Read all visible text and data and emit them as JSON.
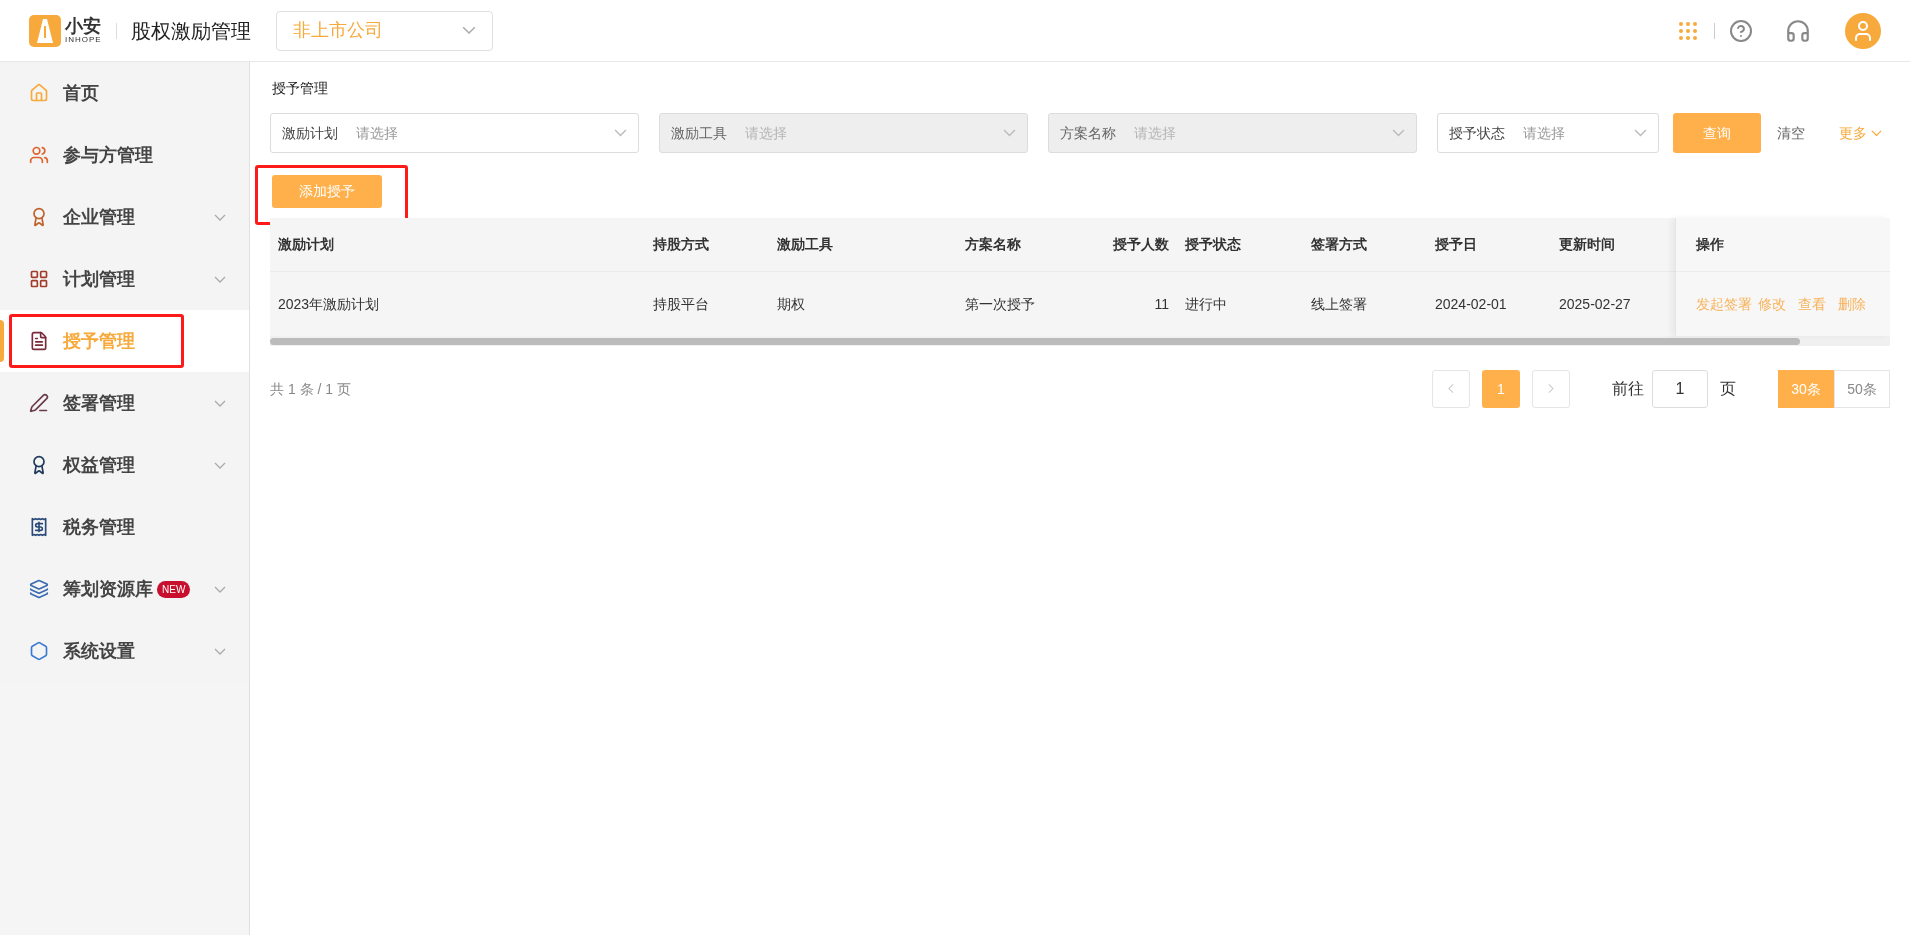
{
  "header": {
    "logo_text": "小安",
    "logo_subtext": "INHOPE",
    "app_title": "股权激励管理",
    "company_select": "非上市公司"
  },
  "sidebar": {
    "items": [
      {
        "label": "首页",
        "expandable": false,
        "selected": false,
        "highlighted": false
      },
      {
        "label": "参与方管理",
        "expandable": false,
        "selected": false,
        "highlighted": false
      },
      {
        "label": "企业管理",
        "expandable": true,
        "selected": false,
        "highlighted": false
      },
      {
        "label": "计划管理",
        "expandable": true,
        "selected": false,
        "highlighted": false
      },
      {
        "label": "授予管理",
        "expandable": false,
        "selected": true,
        "highlighted": true
      },
      {
        "label": "签署管理",
        "expandable": true,
        "selected": false,
        "highlighted": false
      },
      {
        "label": "权益管理",
        "expandable": true,
        "selected": false,
        "highlighted": false
      },
      {
        "label": "税务管理",
        "expandable": false,
        "selected": false,
        "highlighted": false
      },
      {
        "label": "筹划资源库",
        "expandable": true,
        "selected": false,
        "highlighted": false,
        "badge": "NEW"
      },
      {
        "label": "系统设置",
        "expandable": true,
        "selected": false,
        "highlighted": false
      }
    ]
  },
  "page_title": "授予管理",
  "filters": [
    {
      "label": "激励计划",
      "placeholder": "请选择",
      "disabled": false
    },
    {
      "label": "激励工具",
      "placeholder": "请选择",
      "disabled": true
    },
    {
      "label": "方案名称",
      "placeholder": "请选择",
      "disabled": true
    },
    {
      "label": "授予状态",
      "placeholder": "请选择",
      "disabled": false
    }
  ],
  "query_button": "查询",
  "clear_button": "清空",
  "more_button": "更多",
  "add_button": {
    "label": "添加授予",
    "highlighted": true
  },
  "table": {
    "columns": [
      "激励计划",
      "持股方式",
      "激励工具",
      "方案名称",
      "授予人数",
      "授予状态",
      "签署方式",
      "授予日",
      "更新时间"
    ],
    "action_column": "操作",
    "rows": [
      {
        "cells": [
          "2023年激励计划",
          "持股平台",
          "期权",
          "第一次授予",
          "11",
          "进行中",
          "线上签署",
          "2024-02-01",
          "2025-02-27"
        ],
        "actions": [
          "发起签署",
          "修改",
          "查看",
          "删除"
        ]
      }
    ]
  },
  "pagination": {
    "summary": "共 1 条 / 1 页",
    "pages": [
      {
        "label": "1",
        "selected": true
      }
    ],
    "goto_label": "前往",
    "goto_value": "1",
    "goto_suffix": "页",
    "sizes": [
      {
        "label": "30条",
        "selected": true
      },
      {
        "label": "50条",
        "selected": false
      }
    ]
  }
}
